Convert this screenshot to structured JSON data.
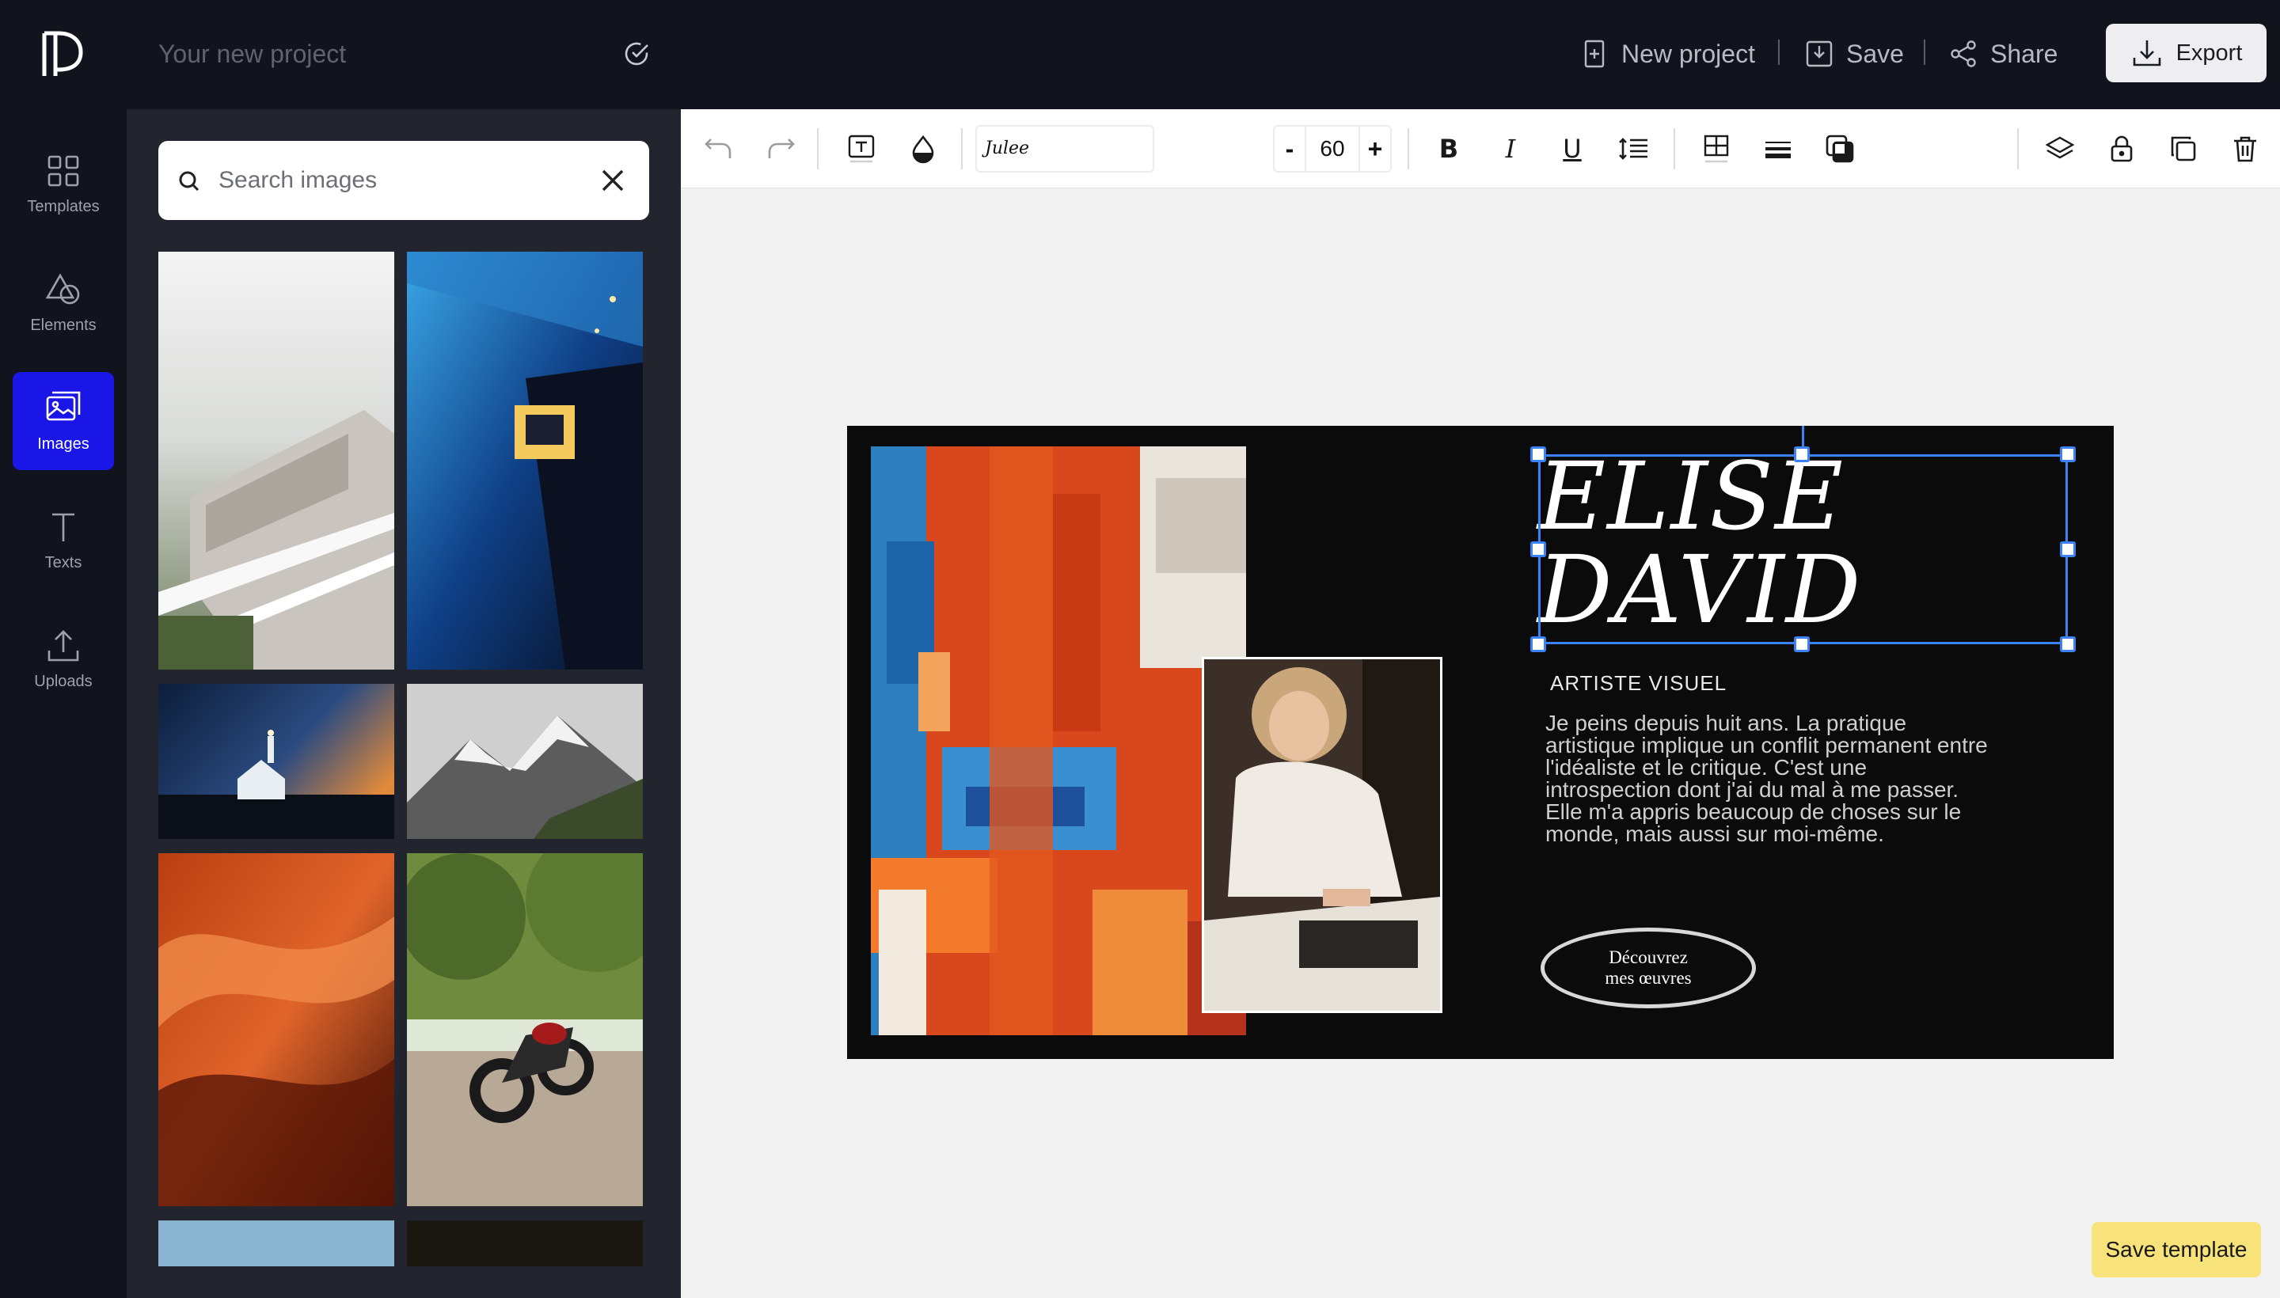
{
  "header": {
    "project_name_placeholder": "Your new project",
    "new_project_label": "New project",
    "save_label": "Save",
    "share_label": "Share",
    "export_label": "Export"
  },
  "sidenav": {
    "items": [
      {
        "label": "Templates",
        "icon": "grid-icon"
      },
      {
        "label": "Elements",
        "icon": "shapes-icon"
      },
      {
        "label": "Images",
        "icon": "image-icon",
        "active": true
      },
      {
        "label": "Texts",
        "icon": "text-icon"
      },
      {
        "label": "Uploads",
        "icon": "upload-icon"
      }
    ]
  },
  "panel": {
    "search_placeholder": "Search images",
    "images": [
      "white-building-terrace",
      "blue-subway-tunnel",
      "chapel-at-dusk",
      "snowy-mountains",
      "red-canyon-rock",
      "motorcycle-tree-road",
      "sky-strip",
      "dark-strip"
    ]
  },
  "toolbar": {
    "font_family": "Julee",
    "font_size": "60",
    "minus_label": "-",
    "plus_label": "+",
    "bold_label": "B",
    "italic_label": "I",
    "underline_label": "U"
  },
  "design": {
    "title_line1": "ELISE",
    "title_line2": "DAVID",
    "subtitle": "ARTISTE VISUEL",
    "body": "Je peins depuis huit ans. La pratique artistique implique un conflit permanent entre l'idéaliste et le critique. C'est une introspection dont j'ai du mal à me passer. Elle m'a appris beaucoup de choses sur le monde, mais aussi sur moi-même.",
    "cta_line1": "Découvrez",
    "cta_line2": "mes œuvres"
  },
  "footer": {
    "save_template_label": "Save template"
  },
  "colors": {
    "topbar": "#12141d",
    "panel": "#22252e",
    "active_nav": "#1a16e8",
    "selection": "#3b82f6",
    "save_template_bg": "#f8e27a"
  }
}
